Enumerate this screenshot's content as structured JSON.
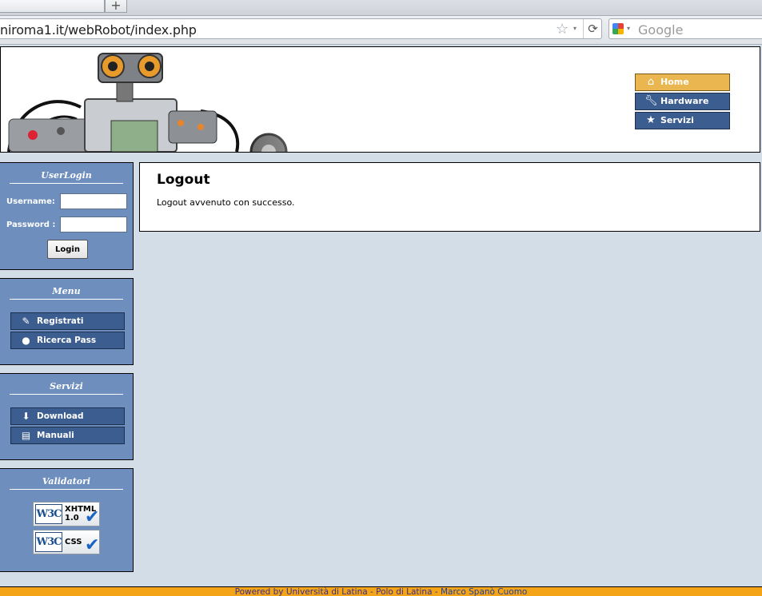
{
  "browser": {
    "new_tab_label": "+",
    "url": "niroma1.it/webRobot/index.php",
    "search_placeholder": "Google"
  },
  "topnav": [
    {
      "label": "Home",
      "icon": "home-icon",
      "active": true
    },
    {
      "label": "Hardware",
      "icon": "wrench-icon",
      "active": false
    },
    {
      "label": "Servizi",
      "icon": "star-icon",
      "active": false
    }
  ],
  "login": {
    "title": "UserLogin",
    "username_label": "Username:",
    "password_label": "Password :",
    "username_value": "",
    "password_value": "",
    "button_label": "Login"
  },
  "menu": {
    "title": "Menu",
    "items": [
      {
        "label": "Registrati",
        "icon": "pencil-icon"
      },
      {
        "label": "Ricerca Pass",
        "icon": "magnifier-icon"
      }
    ]
  },
  "servizi": {
    "title": "Servizi",
    "items": [
      {
        "label": "Download",
        "icon": "download-icon"
      },
      {
        "label": "Manuali",
        "icon": "book-icon"
      }
    ]
  },
  "validatori": {
    "title": "Validatori",
    "badges": [
      {
        "logo": "W3C",
        "line1": "XHTML",
        "line2": "1.0"
      },
      {
        "logo": "W3C",
        "line1": "CSS",
        "line2": ""
      }
    ]
  },
  "content": {
    "title": "Logout",
    "message": "Logout avvenuto con successo."
  },
  "footer": {
    "text": "Powered by Università di Latina - Polo di Latina - ",
    "author": "Marco Spanò Cuomo"
  },
  "colors": {
    "page_background": "#d3dde8",
    "nav_button": "#3b5d8f",
    "nav_active": "#e9b64f",
    "sidebar_box": "#6e8fbd",
    "footer": "#f3a417"
  }
}
